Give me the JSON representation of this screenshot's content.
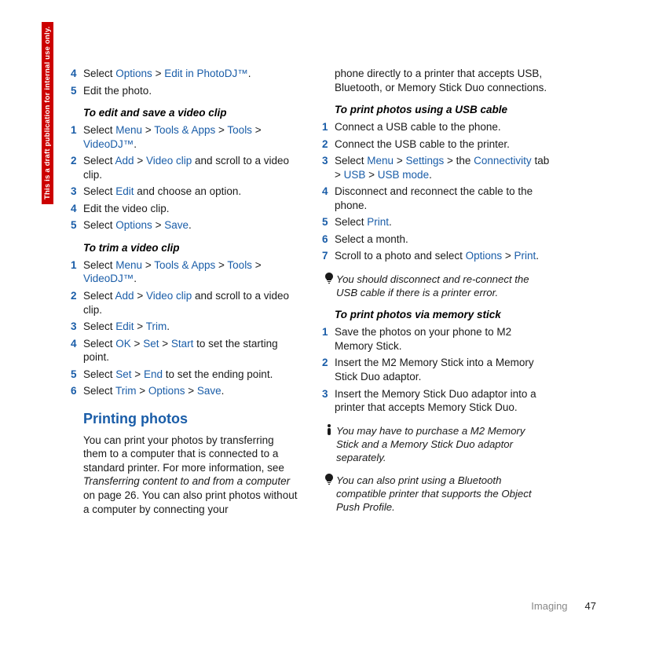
{
  "sidebar_label": "This is a draft publication for internal use only.",
  "left": {
    "top_steps": [
      {
        "num": "4",
        "parts": [
          "Select ",
          "Options",
          " > ",
          "Edit in PhotoDJ™",
          "."
        ]
      },
      {
        "num": "5",
        "parts": [
          "Edit the photo."
        ]
      }
    ],
    "edit_save_head": "To edit and save a video clip",
    "edit_save_steps": [
      {
        "num": "1",
        "parts": [
          "Select ",
          "Menu",
          " > ",
          "Tools & Apps",
          " > ",
          "Tools",
          " > ",
          "VideoDJ™",
          "."
        ]
      },
      {
        "num": "2",
        "parts": [
          "Select ",
          "Add",
          " > ",
          "Video clip",
          " and scroll to a video clip."
        ]
      },
      {
        "num": "3",
        "parts": [
          "Select ",
          "Edit",
          " and choose an option."
        ]
      },
      {
        "num": "4",
        "parts": [
          "Edit the video clip."
        ]
      },
      {
        "num": "5",
        "parts": [
          "Select ",
          "Options",
          " > ",
          "Save",
          "."
        ]
      }
    ],
    "trim_head": "To trim a video clip",
    "trim_steps": [
      {
        "num": "1",
        "parts": [
          "Select ",
          "Menu",
          " > ",
          "Tools & Apps",
          " > ",
          "Tools",
          " > ",
          "VideoDJ™",
          "."
        ]
      },
      {
        "num": "2",
        "parts": [
          "Select ",
          "Add",
          " > ",
          "Video clip",
          " and scroll to a video clip."
        ]
      },
      {
        "num": "3",
        "parts": [
          "Select ",
          "Edit",
          " > ",
          "Trim",
          "."
        ]
      },
      {
        "num": "4",
        "parts": [
          "Select ",
          "OK",
          " > ",
          "Set",
          " > ",
          "Start",
          " to set the starting point."
        ]
      },
      {
        "num": "5",
        "parts": [
          "Select ",
          "Set",
          " > ",
          "End",
          " to set the ending point."
        ]
      },
      {
        "num": "6",
        "parts": [
          "Select ",
          "Trim",
          " > ",
          "Options",
          " > ",
          "Save",
          "."
        ]
      }
    ],
    "print_title": "Printing photos",
    "print_para_pre": "You can print your photos by transferring them to a computer that is connected to a standard printer. For more information, see ",
    "print_para_ital": "Transferring content to and from a computer",
    "print_para_post": " on page 26. You can also print photos without a computer by connecting your"
  },
  "right": {
    "cont": "phone directly to a printer that accepts USB, Bluetooth, or Memory Stick Duo connections.",
    "usb_head": "To print photos using a USB cable",
    "usb_steps": [
      {
        "num": "1",
        "parts": [
          "Connect a USB cable to the phone."
        ]
      },
      {
        "num": "2",
        "parts": [
          "Connect the USB cable to the printer."
        ]
      },
      {
        "num": "3",
        "parts": [
          "Select ",
          "Menu",
          " > ",
          "Settings",
          " > the ",
          "Connectivity",
          " tab > ",
          "USB",
          " > ",
          "USB mode",
          "."
        ]
      },
      {
        "num": "4",
        "parts": [
          "Disconnect and reconnect the cable to the phone."
        ]
      },
      {
        "num": "5",
        "parts": [
          "Select ",
          "Print",
          "."
        ]
      },
      {
        "num": "6",
        "parts": [
          "Select a month."
        ]
      },
      {
        "num": "7",
        "parts": [
          "Scroll to a photo and select ",
          "Options",
          " > ",
          "Print",
          "."
        ]
      }
    ],
    "tip1": "You should disconnect and re-connect the USB cable if there is a printer error.",
    "mem_head": "To print photos via memory stick",
    "mem_steps": [
      {
        "num": "1",
        "parts": [
          "Save the photos on your phone to M2 Memory Stick."
        ]
      },
      {
        "num": "2",
        "parts": [
          "Insert the M2 Memory Stick into a Memory Stick Duo adaptor."
        ]
      },
      {
        "num": "3",
        "parts": [
          "Insert the Memory Stick Duo adaptor into a printer that accepts Memory Stick Duo."
        ]
      }
    ],
    "tip2": "You may have to purchase a M2 Memory Stick and a Memory Stick Duo adaptor separately.",
    "tip3": "You can also print using a Bluetooth compatible printer that supports the Object Push Profile."
  },
  "footer": {
    "section": "Imaging",
    "page": "47"
  },
  "link_indices": {
    "left.top_steps.0": [
      1,
      3
    ],
    "left.edit_save_steps.0": [
      1,
      3,
      5,
      7
    ],
    "left.edit_save_steps.1": [
      1,
      3
    ],
    "left.edit_save_steps.2": [
      1
    ],
    "left.edit_save_steps.4": [
      1,
      3
    ],
    "left.trim_steps.0": [
      1,
      3,
      5,
      7
    ],
    "left.trim_steps.1": [
      1,
      3
    ],
    "left.trim_steps.2": [
      1,
      3
    ],
    "left.trim_steps.3": [
      1,
      3,
      5
    ],
    "left.trim_steps.4": [
      1,
      3
    ],
    "left.trim_steps.5": [
      1,
      3,
      5
    ],
    "right.usb_steps.2": [
      1,
      3,
      5,
      7,
      9
    ],
    "right.usb_steps.4": [
      1
    ],
    "right.usb_steps.6": [
      1,
      3
    ]
  }
}
